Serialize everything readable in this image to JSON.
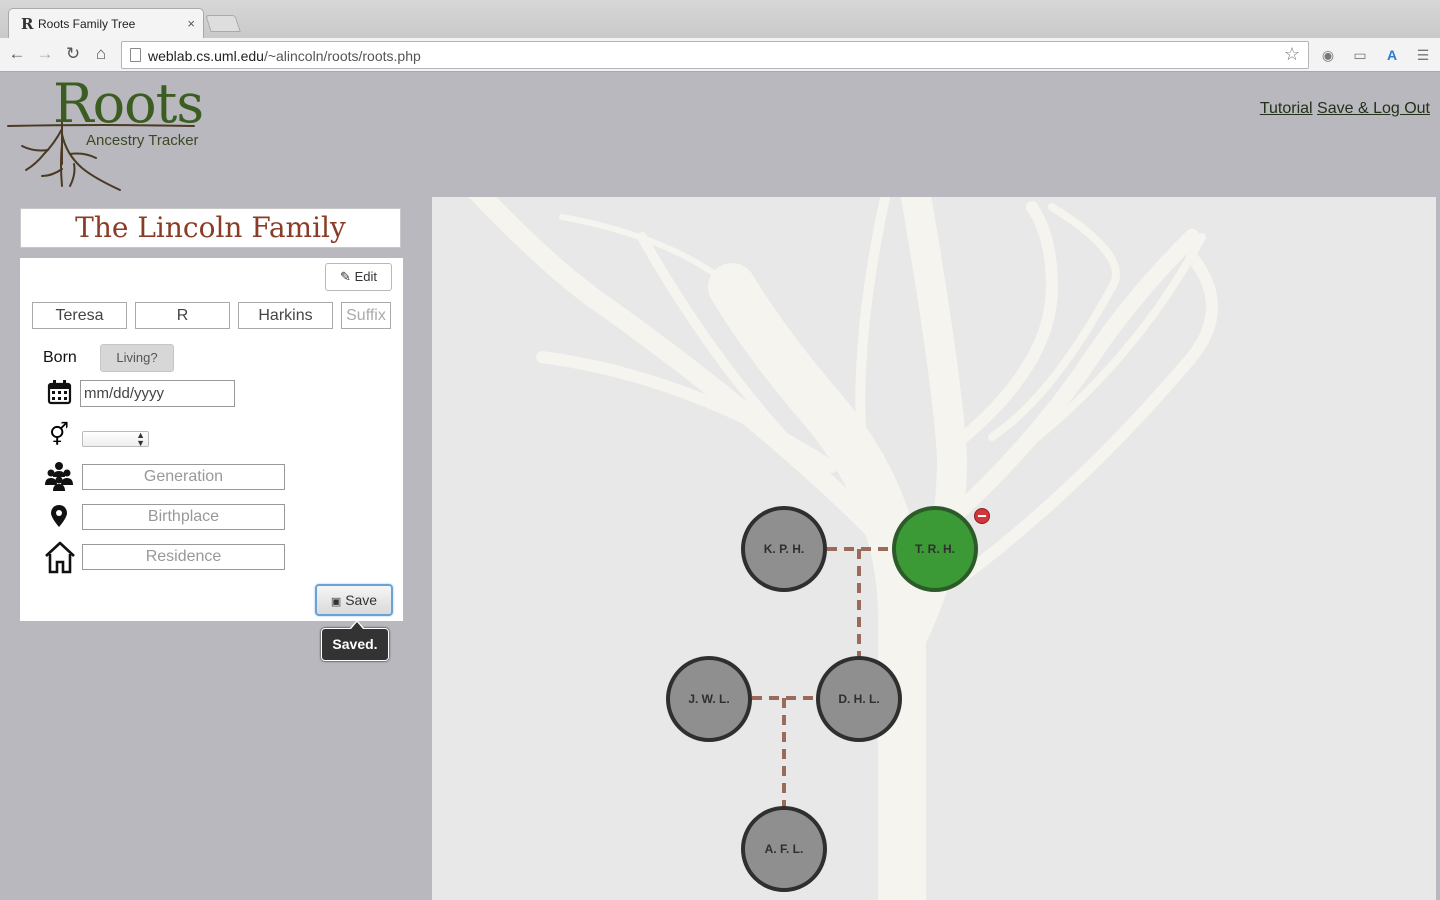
{
  "browser": {
    "tab_title": "Roots Family Tree",
    "tab_favicon": "R",
    "tab_close": "×",
    "url_host": "weblab.cs.uml.edu",
    "url_path": "/~alincoln/roots/roots.php"
  },
  "header": {
    "logo_title": "Roots",
    "logo_subtitle": "Ancestry Tracker",
    "link_tutorial": "Tutorial",
    "link_save_logout": "Save & Log Out"
  },
  "family": {
    "title": "The Lincoln Family"
  },
  "editor": {
    "edit_label": "Edit",
    "first_name": "Teresa",
    "middle_name": "R",
    "last_name": "Harkins",
    "suffix_placeholder": "Suffix",
    "born_label": "Born",
    "living_label": "Living?",
    "date_placeholder": "mm/dd/yyyy",
    "gender_value": "",
    "generation_placeholder": "Generation",
    "birthplace_placeholder": "Birthplace",
    "residence_placeholder": "Residence",
    "save_label": "Save",
    "saved_tooltip": "Saved."
  },
  "tree": {
    "nodes": [
      {
        "id": "kph",
        "label": "K. P. H.",
        "selected": false
      },
      {
        "id": "trh",
        "label": "T. R. H.",
        "selected": true
      },
      {
        "id": "jwl",
        "label": "J. W. L.",
        "selected": false
      },
      {
        "id": "dhl",
        "label": "D. H. L.",
        "selected": false
      },
      {
        "id": "afl",
        "label": "A. F. L.",
        "selected": false
      }
    ],
    "colors": {
      "node": "#8f8f8f",
      "selected_node": "#3b9a35",
      "link": "#9a6a5a",
      "remove": "#d0363a"
    }
  }
}
